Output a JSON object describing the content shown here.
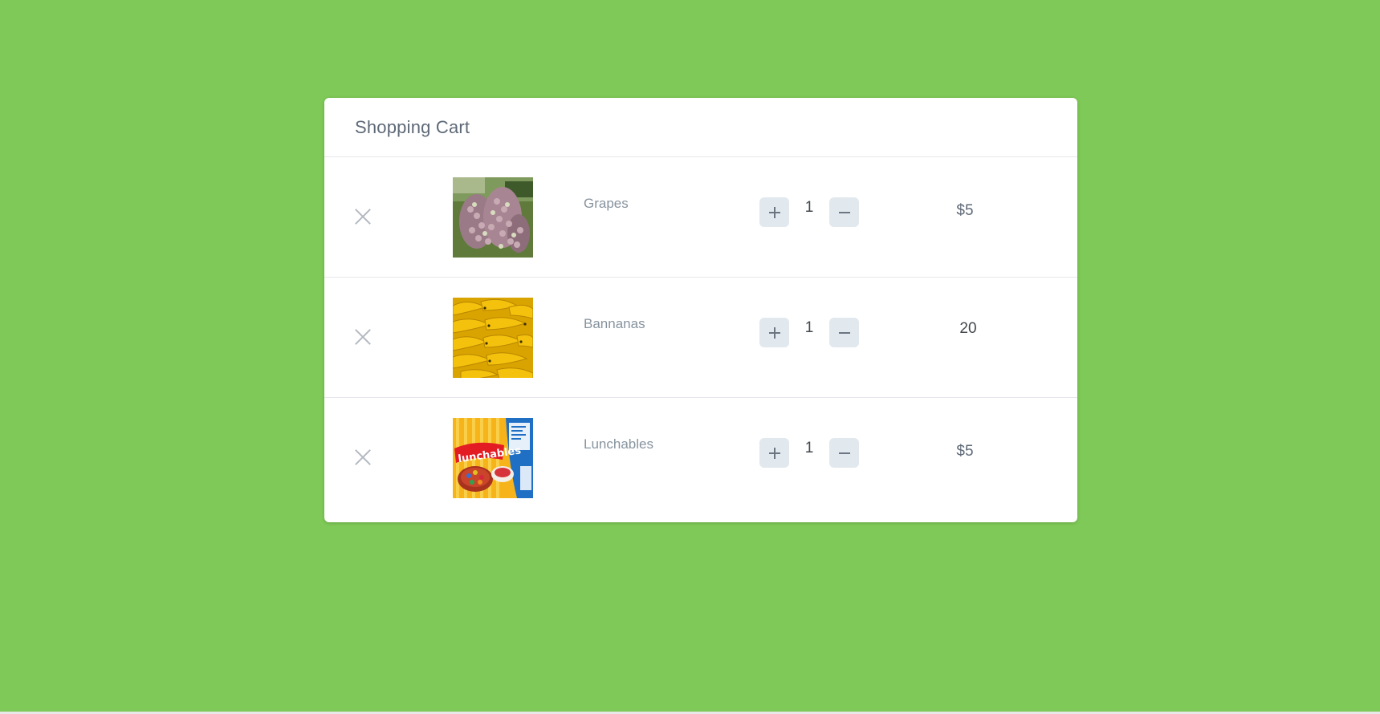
{
  "cart": {
    "title": "Shopping Cart",
    "items": [
      {
        "name": "Grapes",
        "quantity": "1",
        "price": "$5",
        "image": "grapes-photo"
      },
      {
        "name": "Bannanas",
        "quantity": "1",
        "price": "20",
        "image": "bananas-photo"
      },
      {
        "name": "Lunchables",
        "quantity": "1",
        "price": "$5",
        "image": "lunchables-package-photo"
      }
    ]
  },
  "colors": {
    "background": "#7ec957",
    "card": "#ffffff",
    "button": "#e1e8ee",
    "muted_text": "#86939e"
  },
  "icons": {
    "remove": "close-icon",
    "increase": "plus-icon",
    "decrease": "minus-icon"
  }
}
